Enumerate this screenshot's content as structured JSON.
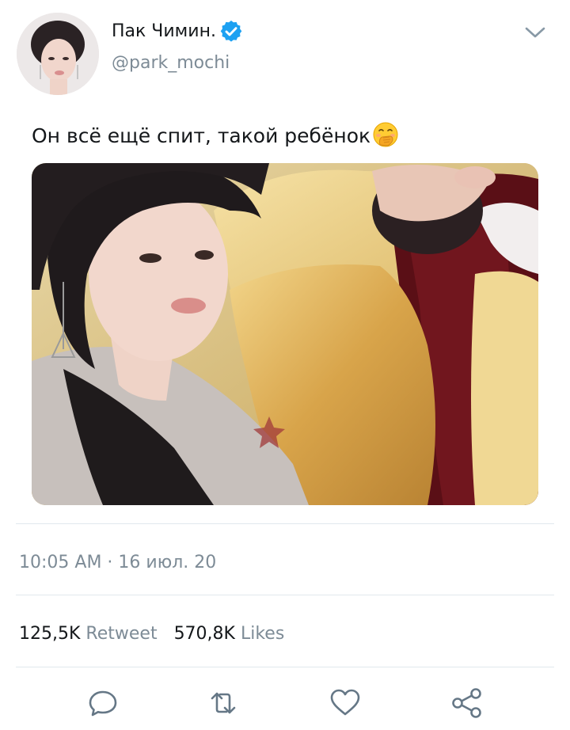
{
  "user": {
    "display_name": "Пак Чимин.",
    "handle": "@park_mochi",
    "verified": true
  },
  "tweet": {
    "text": "Он всё ещё спит, такой ребёнок",
    "emoji": "face-with-hand-over-mouth-emoji",
    "timestamp": "10:05 AM · 16 июл. 20"
  },
  "stats": {
    "retweets_count": "125,5K",
    "retweets_label": "Retweet",
    "likes_count": "570,8K",
    "likes_label": "Likes"
  },
  "icons": {
    "menu": "chevron-down-icon",
    "reply": "reply-icon",
    "retweet": "retweet-icon",
    "like": "heart-icon",
    "share": "share-icon"
  },
  "colors": {
    "accent": "#1da1f2",
    "secondary_text": "#7d8b96",
    "icon_gray": "#657786",
    "divider": "#e1e8ed"
  }
}
